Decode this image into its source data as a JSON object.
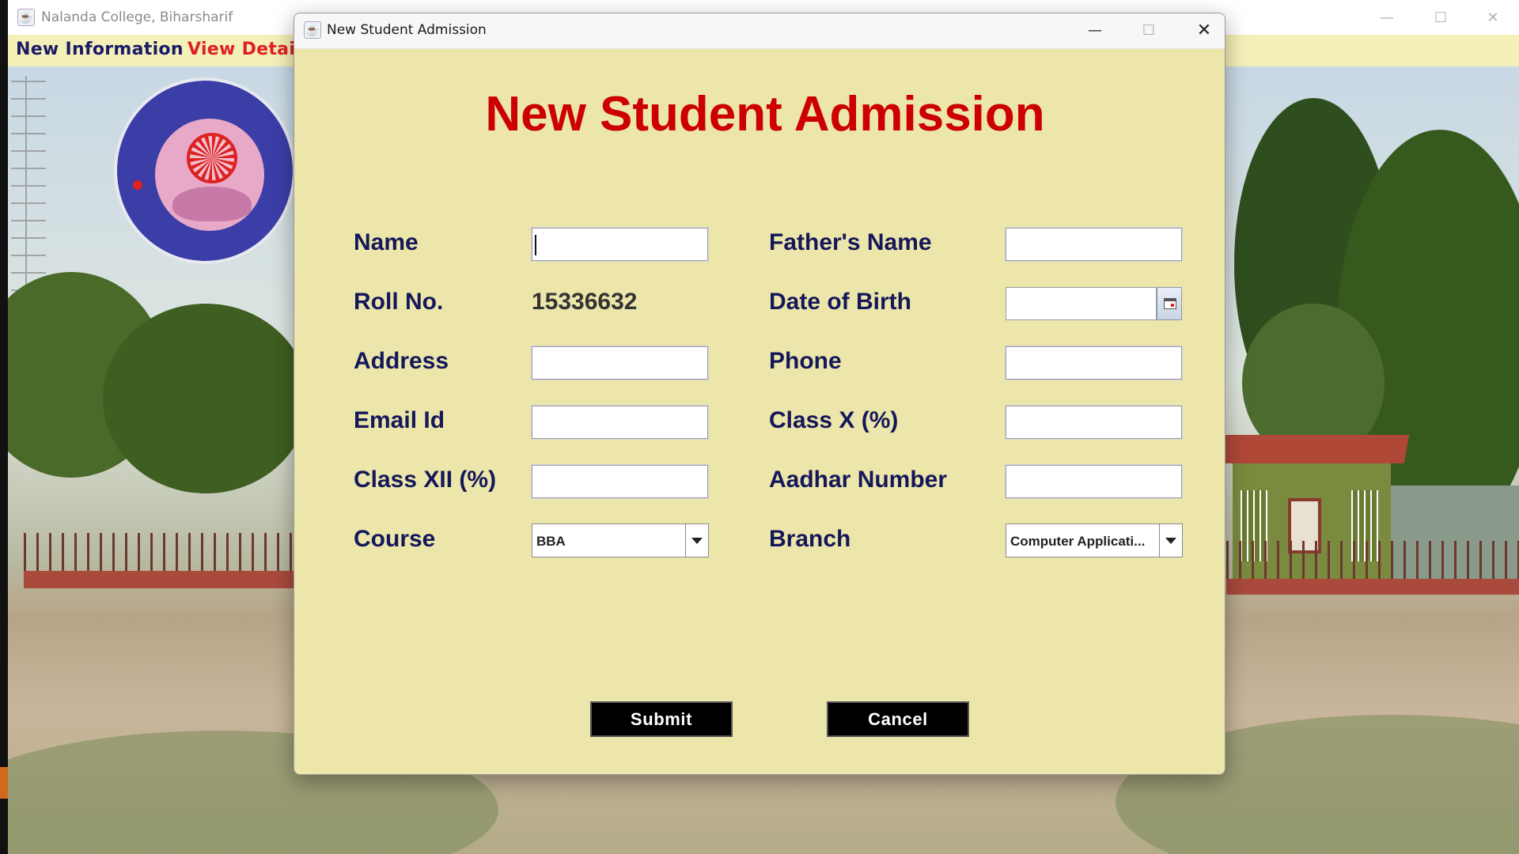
{
  "main_window": {
    "title": "Nalanda College, Biharsharif",
    "menu": [
      {
        "label": "New Information"
      },
      {
        "label": "View Detail"
      }
    ],
    "window_controls": {
      "minimize": "—",
      "maximize": "☐",
      "close": "✕"
    }
  },
  "dialog": {
    "title": "New Student Admission",
    "window_controls": {
      "minimize": "—",
      "maximize": "☐",
      "close": "✕"
    },
    "heading": "New Student Admission",
    "colors": {
      "heading": "#cc0000",
      "label": "#14185a",
      "background": "#ede6aa",
      "button_bg": "#000000",
      "button_text": "#ffffff"
    },
    "fields": {
      "name": {
        "label": "Name",
        "value": ""
      },
      "fathers_name": {
        "label": "Father's Name",
        "value": ""
      },
      "roll_no": {
        "label": "Roll No.",
        "value": "15336632"
      },
      "date_of_birth": {
        "label": "Date of Birth",
        "value": "",
        "button_icon": "calendar-icon"
      },
      "address": {
        "label": "Address",
        "value": ""
      },
      "phone": {
        "label": "Phone",
        "value": ""
      },
      "email": {
        "label": "Email Id",
        "value": ""
      },
      "class_x": {
        "label": "Class X (%)",
        "value": ""
      },
      "class_xii": {
        "label": "Class XII (%)",
        "value": ""
      },
      "aadhar": {
        "label": "Aadhar Number",
        "value": ""
      },
      "course": {
        "label": "Course",
        "selected": "BBA"
      },
      "branch": {
        "label": "Branch",
        "selected": "Computer Applicati..."
      }
    },
    "buttons": {
      "submit": "Submit",
      "cancel": "Cancel"
    }
  }
}
